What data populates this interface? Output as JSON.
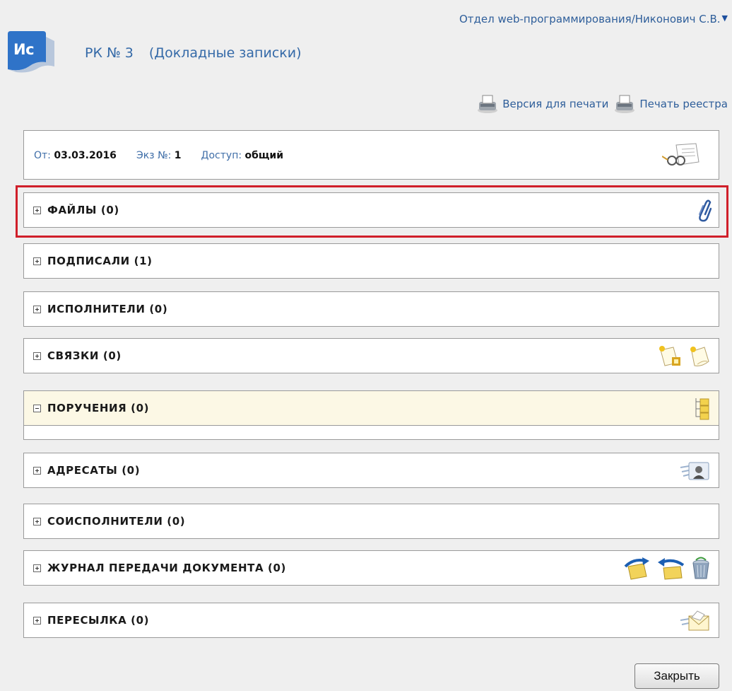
{
  "header": {
    "user_menu": "Отдел web-программирования/Никонович С.В.",
    "logo_text": "Ис",
    "doc_number": "РК № 3",
    "doc_type": "(Докладные записки)"
  },
  "print": {
    "print_version": "Версия для печати",
    "print_registry": "Печать реестра"
  },
  "info": {
    "from_label": "От:",
    "from_value": "03.03.2016",
    "copy_label": "Экз №:",
    "copy_value": "1",
    "access_label": "Доступ:",
    "access_value": "общий"
  },
  "sections": [
    {
      "label": "ФАЙЛЫ (0)",
      "state": "collapsed",
      "icons": [
        "paperclip-icon"
      ]
    },
    {
      "label": "ПОДПИСАЛИ (1)",
      "state": "collapsed",
      "icons": []
    },
    {
      "label": "ИСПОЛНИТЕЛИ (0)",
      "state": "collapsed",
      "icons": []
    },
    {
      "label": "СВЯЗКИ (0)",
      "state": "collapsed",
      "icons": [
        "add-link-icon",
        "add-note-icon"
      ]
    },
    {
      "label": "ПОРУЧЕНИЯ (0)",
      "state": "expanded",
      "icons": [
        "folder-tree-icon"
      ]
    },
    {
      "label": "АДРЕСАТЫ (0)",
      "state": "collapsed",
      "icons": [
        "contact-card-icon"
      ]
    },
    {
      "label": "СОИСПОЛНИТЕЛИ (0)",
      "state": "collapsed",
      "icons": []
    },
    {
      "label": "ЖУРНАЛ ПЕРЕДАЧИ ДОКУМЕНТА (0)",
      "state": "collapsed",
      "icons": [
        "send-document-icon",
        "return-document-icon",
        "recycle-bin-icon"
      ]
    },
    {
      "label": "ПЕРЕСЫЛКА (0)",
      "state": "collapsed",
      "icons": [
        "forward-mail-icon"
      ]
    }
  ],
  "footer": {
    "close_label": "Закрыть"
  },
  "colors": {
    "link": "#2e5e9a",
    "logo": "#2f73c8",
    "highlight": "#d01f2a",
    "expanded_bg": "#fcf8e5"
  }
}
